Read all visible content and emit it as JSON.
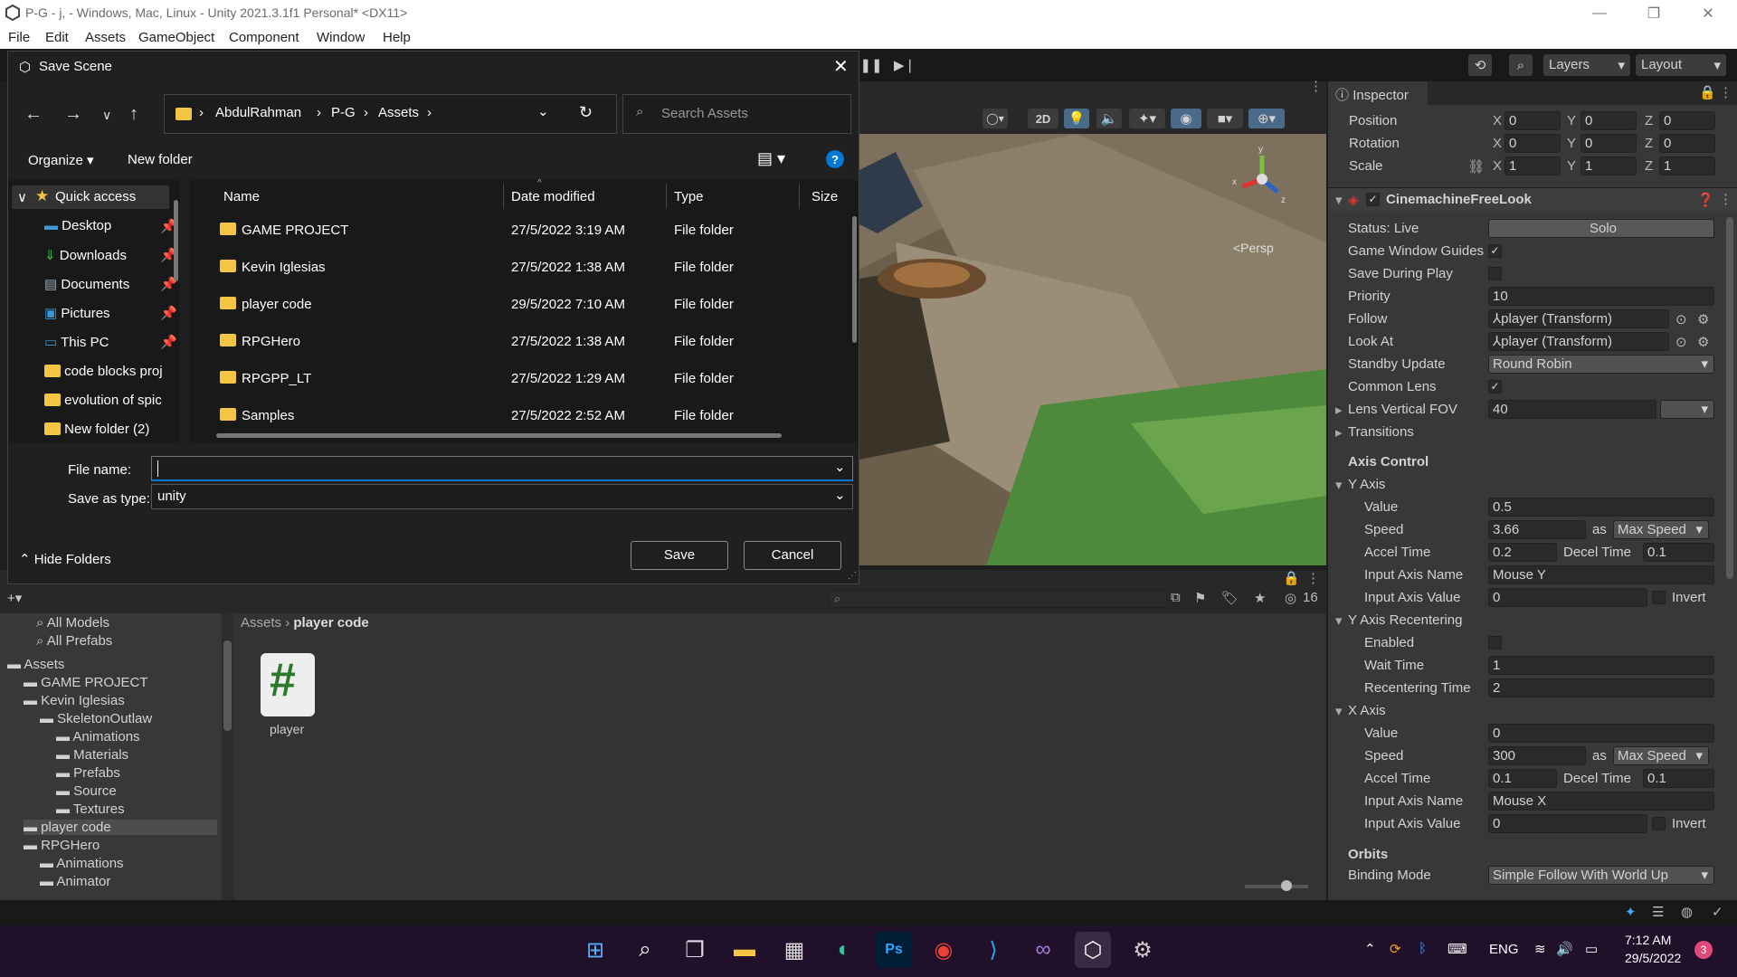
{
  "window": {
    "title": "P-G - j, - Windows, Mac, Linux - Unity 2021.3.1f1 Personal* <DX11>"
  },
  "menu": [
    "File",
    "Edit",
    "Assets",
    "GameObject",
    "Component",
    "Window",
    "Help"
  ],
  "toolbar": {
    "layers": "Layers",
    "layout": "Layout"
  },
  "scene": {
    "persp": "<Persp",
    "toggle_2d": "2D",
    "axis_y": "y",
    "axis_x": "x",
    "axis_z": "z"
  },
  "dialog": {
    "title": "Save Scene",
    "breadcrumb": [
      "AbdulRahman",
      "P-G",
      "Assets"
    ],
    "search_placeholder": "Search Assets",
    "organize": "Organize",
    "new_folder": "New folder",
    "columns": [
      "Name",
      "Date modified",
      "Type",
      "Size"
    ],
    "nav": [
      "Quick access",
      "Desktop",
      "Downloads",
      "Documents",
      "Pictures",
      "This PC",
      "code blocks proj",
      "evolution of spic",
      "New folder (2)"
    ],
    "files": [
      {
        "name": "GAME PROJECT",
        "date": "27/5/2022 3:19 AM",
        "type": "File folder"
      },
      {
        "name": "Kevin Iglesias",
        "date": "27/5/2022 1:38 AM",
        "type": "File folder"
      },
      {
        "name": "player code",
        "date": "29/5/2022 7:10 AM",
        "type": "File folder"
      },
      {
        "name": "RPGHero",
        "date": "27/5/2022 1:38 AM",
        "type": "File folder"
      },
      {
        "name": "RPGPP_LT",
        "date": "27/5/2022 1:29 AM",
        "type": "File folder"
      },
      {
        "name": "Samples",
        "date": "27/5/2022 2:52 AM",
        "type": "File folder"
      }
    ],
    "file_name_label": "File name:",
    "file_name_value": "",
    "save_type_label": "Save as type:",
    "save_type_value": "unity",
    "hide_folders": "Hide Folders",
    "save": "Save",
    "cancel": "Cancel"
  },
  "inspector": {
    "tab": "Inspector",
    "transform": {
      "position_label": "Position",
      "rotation_label": "Rotation",
      "scale_label": "Scale",
      "position": [
        "0",
        "0",
        "0"
      ],
      "rotation": [
        "0",
        "0",
        "0"
      ],
      "scale": [
        "1",
        "1",
        "1"
      ]
    },
    "component": "CinemachineFreeLook",
    "status_label": "Status: Live",
    "solo": "Solo",
    "game_window_guides": "Game Window Guides",
    "save_during_play": "Save During Play",
    "priority_label": "Priority",
    "priority": "10",
    "follow_label": "Follow",
    "follow": "player (Transform)",
    "lookat_label": "Look At",
    "lookat": "player (Transform)",
    "standby_label": "Standby Update",
    "standby": "Round Robin",
    "common_lens": "Common Lens",
    "fov_label": "Lens Vertical FOV",
    "fov": "40",
    "transitions": "Transitions",
    "axis_control": "Axis Control",
    "y_axis": "Y Axis",
    "value_label": "Value",
    "speed_label": "Speed",
    "as": "as",
    "max_speed": "Max Speed",
    "accel_label": "Accel Time",
    "decel_label": "Decel Time",
    "input_name_label": "Input Axis Name",
    "input_value_label": "Input Axis Value",
    "invert": "Invert",
    "y": {
      "value": "0.5",
      "speed": "3.66",
      "accel": "0.2",
      "decel": "0.1",
      "input_name": "Mouse Y",
      "input_value": "0"
    },
    "y_recentering": "Y Axis Recentering",
    "enabled_label": "Enabled",
    "wait_label": "Wait Time",
    "wait": "1",
    "recenter_label": "Recentering Time",
    "recenter": "2",
    "x_axis": "X Axis",
    "x": {
      "value": "0",
      "speed": "300",
      "accel": "0.1",
      "decel": "0.1",
      "input_name": "Mouse X",
      "input_value": "0"
    },
    "orbits": "Orbits",
    "binding_label": "Binding Mode",
    "binding": "Simple Follow With World Up"
  },
  "project": {
    "path": [
      "Assets",
      "player code"
    ],
    "search_count": "16",
    "tree": [
      {
        "label": "All Models",
        "indent": 0
      },
      {
        "label": "All Prefabs",
        "indent": 0
      },
      {
        "label": "Assets",
        "indent": 0
      },
      {
        "label": "GAME PROJECT",
        "indent": 1
      },
      {
        "label": "Kevin Iglesias",
        "indent": 1
      },
      {
        "label": "SkeletonOutlaw",
        "indent": 2
      },
      {
        "label": "Animations",
        "indent": 3
      },
      {
        "label": "Materials",
        "indent": 3
      },
      {
        "label": "Prefabs",
        "indent": 3
      },
      {
        "label": "Source",
        "indent": 3
      },
      {
        "label": "Textures",
        "indent": 3
      },
      {
        "label": "player code",
        "indent": 1
      },
      {
        "label": "RPGHero",
        "indent": 1
      },
      {
        "label": "Animations",
        "indent": 2
      },
      {
        "label": "Animator",
        "indent": 2
      }
    ],
    "asset": "player"
  },
  "taskbar": {
    "lang": "ENG",
    "time": "7:12 AM",
    "date": "29/5/2022",
    "badge": "3"
  },
  "colors": {
    "accent": "#0078d4",
    "unity_bg": "#383838",
    "taskbar": "#20102a"
  }
}
